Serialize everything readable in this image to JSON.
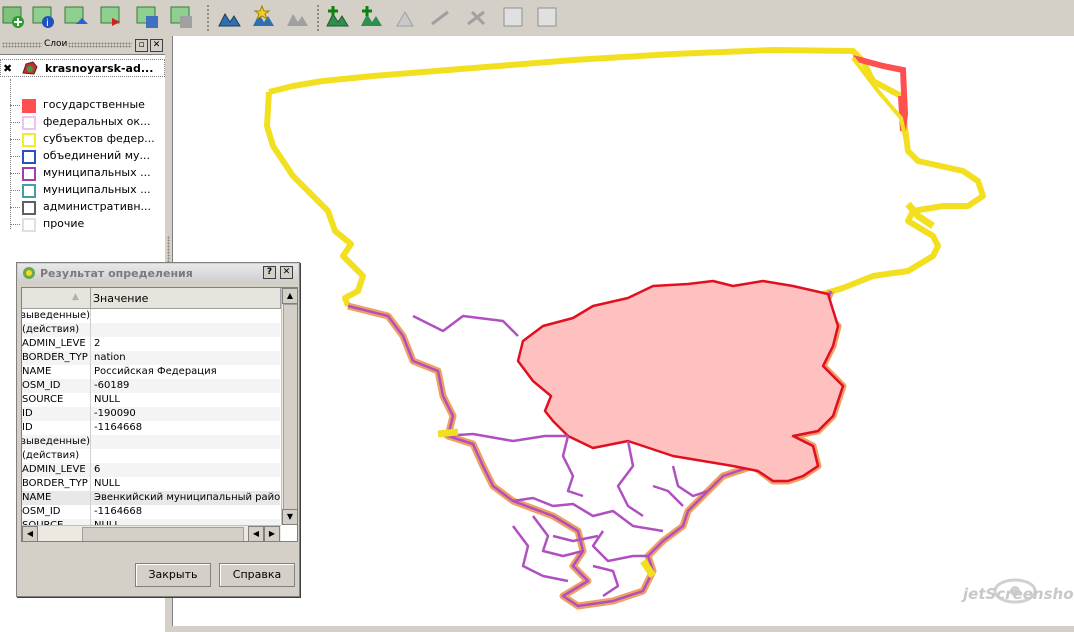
{
  "layers_panel": {
    "title": "Слои",
    "layer_name": "krasnoyarsk-ad...",
    "legend": [
      {
        "label": "государственные",
        "color": "#ff5050",
        "fill": "#ff5050"
      },
      {
        "label": "федеральных ок...",
        "color": "#f4c0f0",
        "fill": "#ffffff"
      },
      {
        "label": "субъектов федер...",
        "color": "#f2ea2a",
        "fill": "#ffffff"
      },
      {
        "label": "объединений му...",
        "color": "#2850c8",
        "fill": "#ffffff"
      },
      {
        "label": "муниципальных ...",
        "color": "#a040b0",
        "fill": "#ffffff"
      },
      {
        "label": "муниципальных ...",
        "color": "#40a0a0",
        "fill": "#ffffff"
      },
      {
        "label": "административн...",
        "color": "#606060",
        "fill": "#ffffff"
      },
      {
        "label": "прочие",
        "color": "#e0e0e0",
        "fill": "#ffffff"
      }
    ]
  },
  "dialog": {
    "title": "Результат определения",
    "help_glyph": "?",
    "close_glyph": "✕",
    "col_value_header": "Значение",
    "rows": [
      {
        "k": "(выведенные)",
        "v": ""
      },
      {
        "k": "(действия)",
        "v": ""
      },
      {
        "k": "ADMIN_LEVE",
        "v": "2"
      },
      {
        "k": "BORDER_TYP",
        "v": "nation"
      },
      {
        "k": "NAME",
        "v": "Российская Федерация"
      },
      {
        "k": "OSM_ID",
        "v": "-60189"
      },
      {
        "k": "SOURCE",
        "v": "NULL"
      },
      {
        "k": "ID",
        "v": "-190090"
      },
      {
        "k": "ID",
        "v": "-1164668"
      },
      {
        "k": "(выведенные)",
        "v": ""
      },
      {
        "k": "(действия)",
        "v": ""
      },
      {
        "k": "ADMIN_LEVE",
        "v": "6"
      },
      {
        "k": "BORDER_TYP",
        "v": "NULL"
      },
      {
        "k": "NAME",
        "v": "Эвенкийский муниципальный район"
      },
      {
        "k": "OSM_ID",
        "v": "-1164668"
      },
      {
        "k": "SOURCE",
        "v": "NULL"
      }
    ],
    "close_button": "Закрыть",
    "help_button": "Справка"
  },
  "toolbar": {
    "icons": [
      "new-layer-icon",
      "layer-info-icon",
      "move-layer-icon",
      "remove-layer-icon",
      "save-layer-icon",
      "export-layer-icon",
      "add-raster-icon",
      "add-favorite-icon",
      "disabled-tool-icon",
      "add-vector-icon",
      "add-feature-icon",
      "move-feature-icon",
      "node-tool-icon",
      "split-tool-icon",
      "merge-tool-icon",
      "form-tool-icon"
    ]
  },
  "watermark": "jetScreenshot"
}
